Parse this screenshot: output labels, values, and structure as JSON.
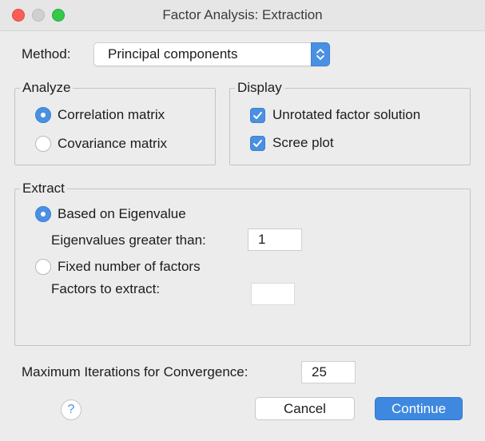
{
  "window": {
    "title": "Factor Analysis: Extraction"
  },
  "method": {
    "label": "Method:",
    "selected": "Principal components"
  },
  "analyze": {
    "legend": "Analyze",
    "options": [
      {
        "label": "Correlation matrix",
        "selected": true
      },
      {
        "label": "Covariance matrix",
        "selected": false
      }
    ]
  },
  "display": {
    "legend": "Display",
    "options": [
      {
        "label": "Unrotated factor solution",
        "checked": true
      },
      {
        "label": "Scree plot",
        "checked": true
      }
    ]
  },
  "extract": {
    "legend": "Extract",
    "based_on_eigenvalue": {
      "label": "Based on Eigenvalue",
      "selected": true
    },
    "eigen_label": "Eigenvalues greater than:",
    "eigen_value": "1",
    "fixed_number": {
      "label": "Fixed number of factors",
      "selected": false
    },
    "factors_label": "Factors to extract:",
    "factors_value": ""
  },
  "iterations": {
    "label": "Maximum Iterations for Convergence:",
    "value": "25"
  },
  "buttons": {
    "help": "?",
    "cancel": "Cancel",
    "continue": "Continue"
  },
  "colors": {
    "accent": "#4a90e2",
    "close": "#fc5e57",
    "maximize": "#35c84a",
    "background": "#ececec"
  }
}
